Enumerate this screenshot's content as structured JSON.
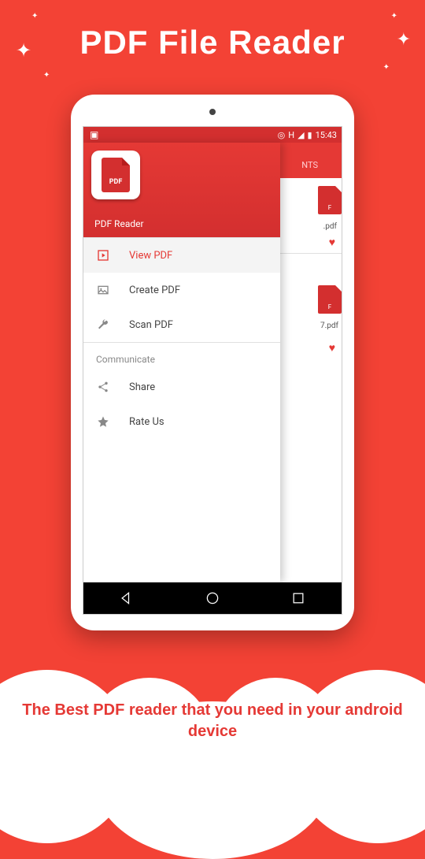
{
  "promo": {
    "title": "PDF File Reader",
    "footer": "The Best PDF reader that you need in your android device"
  },
  "status_bar": {
    "time": "15:43",
    "signal_label": "H"
  },
  "drawer": {
    "header_title": "PDF Reader",
    "logo_text": "PDF",
    "items_main": [
      {
        "icon": "play-icon",
        "label": "View PDF",
        "active": true
      },
      {
        "icon": "image-icon",
        "label": "Create PDF",
        "active": false
      },
      {
        "icon": "wrench-icon",
        "label": "Scan PDF",
        "active": false
      }
    ],
    "section_label": "Communicate",
    "items_comm": [
      {
        "icon": "share-icon",
        "label": "Share"
      },
      {
        "icon": "star-icon",
        "label": "Rate Us"
      }
    ]
  },
  "background": {
    "tab_label": "NTS",
    "files": [
      {
        "name": ".pdf",
        "icon_text": "F"
      },
      {
        "name": "7.pdf",
        "icon_text": "F"
      }
    ]
  }
}
